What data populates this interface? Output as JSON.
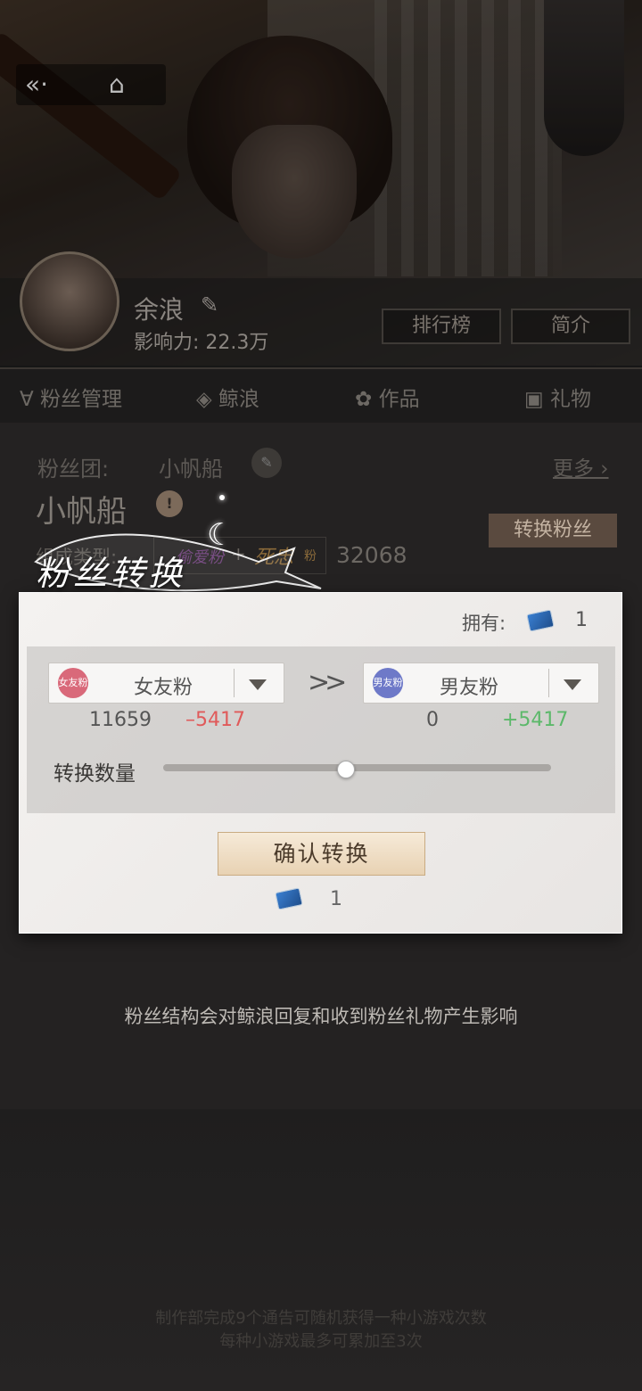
{
  "profile": {
    "name": "余浪",
    "influence": "影响力: 22.3万",
    "ranking_button": "排行榜",
    "intro_button": "简介"
  },
  "tabs": [
    "粉丝管理",
    "鲸浪",
    "作品",
    "礼物"
  ],
  "fan_group": {
    "label": "粉丝团:",
    "name": "小帆船",
    "more": "更多",
    "title": "小帆船",
    "convert_button": "转换粉丝",
    "composition_label": "组成类型:",
    "type_a": "偷爱粉",
    "plus": "+",
    "type_b": "死忠",
    "type_b_suffix": "粉",
    "total": "32068"
  },
  "modal": {
    "title": "粉丝转换",
    "own_label": "拥有:",
    "own_count": "1",
    "from": {
      "badge": "女友粉",
      "label": "女友粉",
      "count": "11659",
      "delta": "–5417",
      "badge_color": "#d9697a"
    },
    "to": {
      "badge": "男友粉",
      "label": "男友粉",
      "count": "0",
      "delta": "+5417",
      "badge_color": "#6e79c8"
    },
    "arrows": "»",
    "slider_label": "转换数量",
    "slider_value": 0.47,
    "confirm_button": "确认转换",
    "cost_count": "1",
    "delta_negative_color": "#e05a5a",
    "delta_positive_color": "#5cb86a"
  },
  "note": "粉丝结构会对鲸浪回复和收到粉丝礼物产生影响",
  "bottom_hint": {
    "line1": "制作部完成9个通告可随机获得一种小游戏次数",
    "line2": "每种小游戏最多可累加至3次"
  }
}
